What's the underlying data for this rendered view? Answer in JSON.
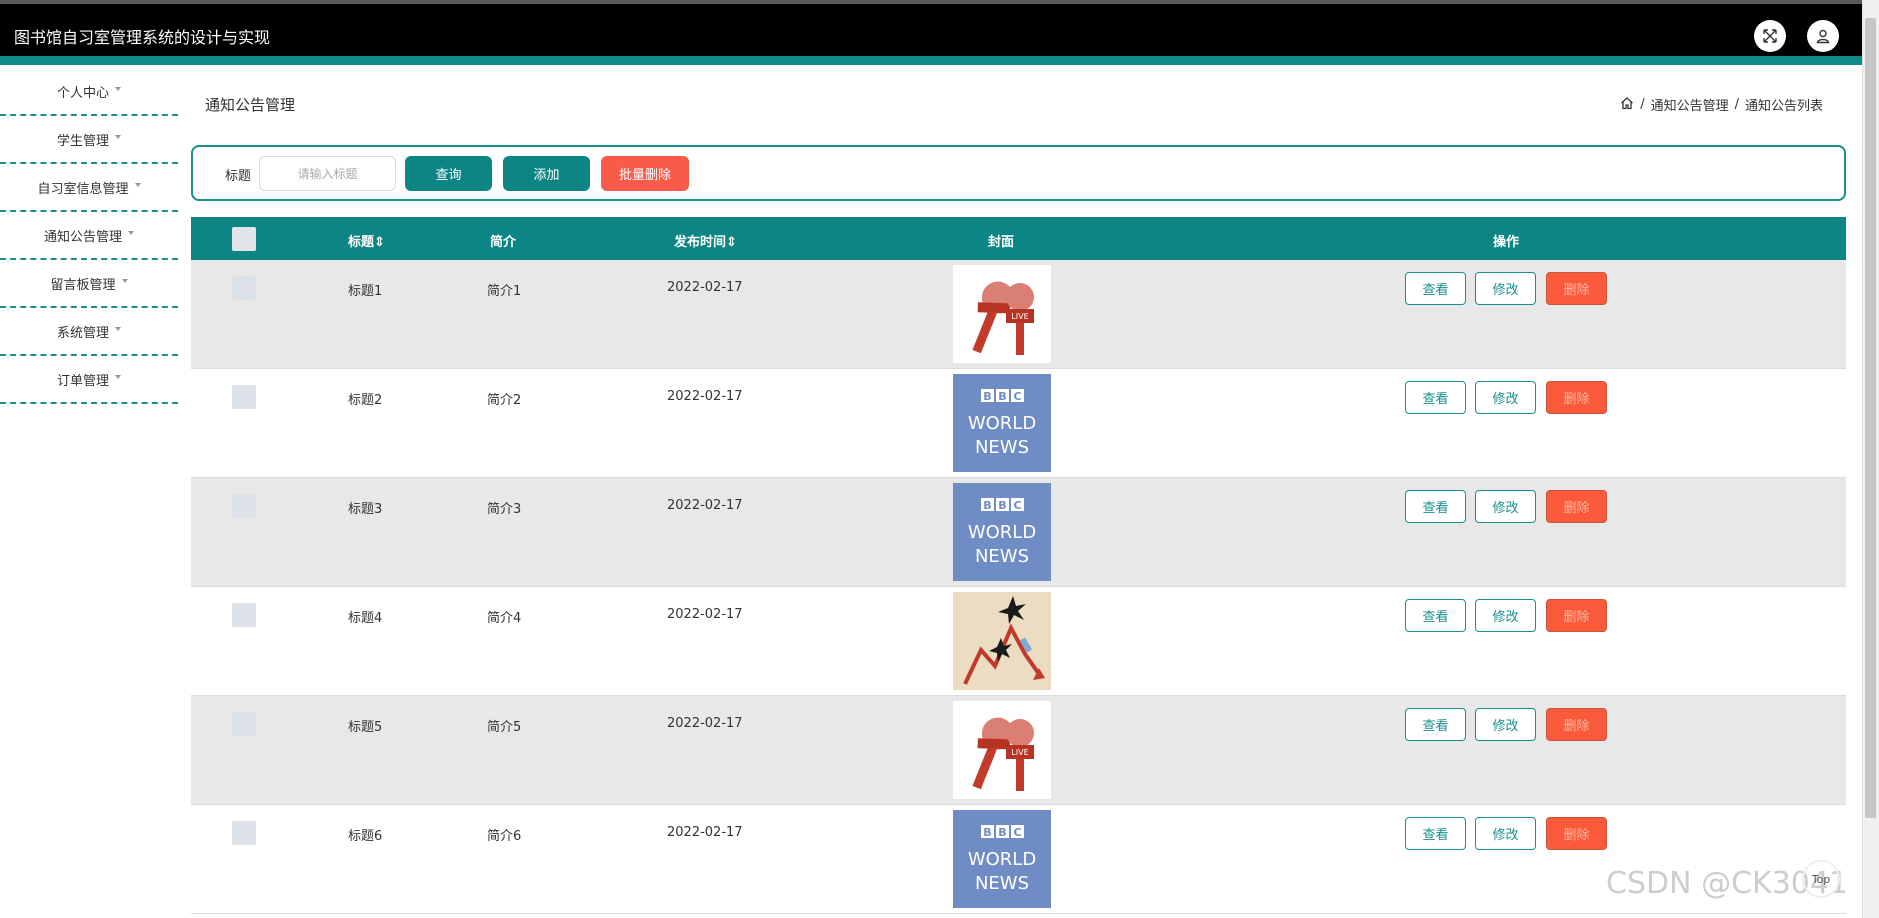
{
  "header": {
    "app_title": "图书馆自习室管理系统的设计与实现",
    "icons": [
      "fullscreen-icon",
      "user-icon"
    ]
  },
  "sidebar": {
    "items": [
      {
        "label": "个人中心"
      },
      {
        "label": "学生管理"
      },
      {
        "label": "自习室信息管理"
      },
      {
        "label": "通知公告管理"
      },
      {
        "label": "留言板管理"
      },
      {
        "label": "系统管理"
      },
      {
        "label": "订单管理"
      }
    ]
  },
  "page": {
    "title": "通知公告管理",
    "breadcrumb": [
      "通知公告管理",
      "通知公告列表"
    ]
  },
  "search": {
    "label": "标题",
    "placeholder": "请输入标题",
    "query_label": "查询",
    "add_label": "添加",
    "batch_delete_label": "批量删除"
  },
  "table": {
    "headers": {
      "title": "标题",
      "summary": "简介",
      "publish_time": "发布时间",
      "cover": "封面",
      "actions": "操作"
    },
    "action_labels": {
      "view": "查看",
      "edit": "修改",
      "delete": "删除"
    },
    "rows": [
      {
        "title": "标题1",
        "summary": "简介1",
        "publish_time": "2022-02-17",
        "cover": "news-microphones-image"
      },
      {
        "title": "标题2",
        "summary": "简介2",
        "publish_time": "2022-02-17",
        "cover": "bbc-world-news-image"
      },
      {
        "title": "标题3",
        "summary": "简介3",
        "publish_time": "2022-02-17",
        "cover": "bbc-world-news-image"
      },
      {
        "title": "标题4",
        "summary": "简介4",
        "publish_time": "2022-02-17",
        "cover": "falling-chart-image"
      },
      {
        "title": "标题5",
        "summary": "简介5",
        "publish_time": "2022-02-17",
        "cover": "news-microphones-image"
      },
      {
        "title": "标题6",
        "summary": "简介6",
        "publish_time": "2022-02-17",
        "cover": "bbc-world-news-image"
      }
    ]
  },
  "bbc_logo": {
    "line1": "BBC",
    "line2": "WORLD",
    "line3": "NEWS"
  },
  "watermark": "CSDN @CK3041",
  "back_to_top": "Top",
  "colors": {
    "primary": "#0d8585",
    "danger": "#fa5a3a",
    "header": "#000000"
  }
}
